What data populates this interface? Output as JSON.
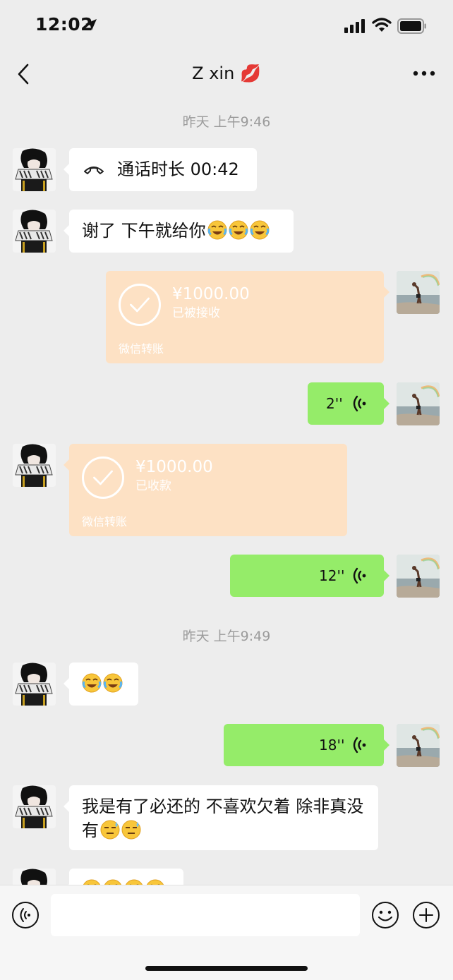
{
  "status_bar": {
    "time": "12:02"
  },
  "header": {
    "title": "Z xin 💋"
  },
  "timestamps": [
    "昨天 上午9:46",
    "昨天 上午9:49"
  ],
  "messages": {
    "call": {
      "text": "通话时长 00:42"
    },
    "thanks": {
      "text": "谢了 下午就给你"
    },
    "transfer_sent": {
      "amount": "¥1000.00",
      "status": "已被接收",
      "label": "微信转账"
    },
    "voice_1": {
      "duration": "2''"
    },
    "transfer_received": {
      "amount": "¥1000.00",
      "status": "已收款",
      "label": "微信转账"
    },
    "voice_2": {
      "duration": "12''"
    },
    "voice_3": {
      "duration": "18''"
    },
    "long_text": {
      "text": "我是有了必还的 不喜欢欠着 除非真没有"
    }
  },
  "input": {
    "placeholder": ""
  },
  "colors": {
    "background": "#ededed",
    "sent_bubble": "#95ec69",
    "received_bubble": "#ffffff",
    "transfer_bubble": "#fde1c4",
    "timestamp": "#9b9b9b"
  },
  "icons": [
    "location-arrow-icon",
    "signal-icon",
    "wifi-icon",
    "battery-icon",
    "back-icon",
    "more-icon",
    "phone-hangup-icon",
    "laughing-tears-emoji",
    "check-circle-icon",
    "voice-wave-icon",
    "sweat-emoji",
    "voice-input-icon",
    "emoji-icon",
    "plus-icon"
  ]
}
